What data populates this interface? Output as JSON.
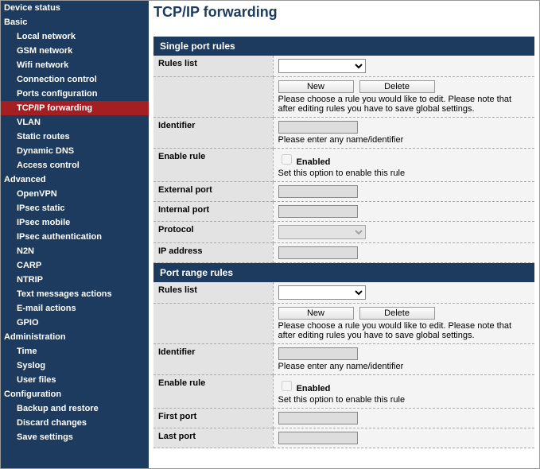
{
  "sidebar": [
    {
      "label": "Device status",
      "type": "group"
    },
    {
      "label": "Basic",
      "type": "group"
    },
    {
      "label": "Local network",
      "type": "child"
    },
    {
      "label": "GSM network",
      "type": "child"
    },
    {
      "label": "Wifi network",
      "type": "child"
    },
    {
      "label": "Connection control",
      "type": "child"
    },
    {
      "label": "Ports configuration",
      "type": "child"
    },
    {
      "label": "TCP/IP forwarding",
      "type": "child",
      "active": true
    },
    {
      "label": "VLAN",
      "type": "child"
    },
    {
      "label": "Static routes",
      "type": "child"
    },
    {
      "label": "Dynamic DNS",
      "type": "child"
    },
    {
      "label": "Access control",
      "type": "child"
    },
    {
      "label": "Advanced",
      "type": "group"
    },
    {
      "label": "OpenVPN",
      "type": "child"
    },
    {
      "label": "IPsec static",
      "type": "child"
    },
    {
      "label": "IPsec mobile",
      "type": "child"
    },
    {
      "label": "IPsec authentication",
      "type": "child"
    },
    {
      "label": "N2N",
      "type": "child"
    },
    {
      "label": "CARP",
      "type": "child"
    },
    {
      "label": "NTRIP",
      "type": "child"
    },
    {
      "label": "Text messages actions",
      "type": "child"
    },
    {
      "label": "E-mail actions",
      "type": "child"
    },
    {
      "label": "GPIO",
      "type": "child"
    },
    {
      "label": "Administration",
      "type": "group"
    },
    {
      "label": "Time",
      "type": "child"
    },
    {
      "label": "Syslog",
      "type": "child"
    },
    {
      "label": "User files",
      "type": "child"
    },
    {
      "label": "Configuration",
      "type": "group"
    },
    {
      "label": "Backup and restore",
      "type": "child"
    },
    {
      "label": "Discard changes",
      "type": "child"
    },
    {
      "label": "Save settings",
      "type": "child"
    }
  ],
  "page": {
    "title": "TCP/IP forwarding"
  },
  "single": {
    "section_title": "Single port rules",
    "labels": {
      "rules_list": "Rules list",
      "identifier": "Identifier",
      "enable_rule": "Enable rule",
      "external_port": "External port",
      "internal_port": "Internal port",
      "protocol": "Protocol",
      "ip_address": "IP address"
    },
    "buttons": {
      "new": "New",
      "delete": "Delete"
    },
    "help": {
      "rules_list": "Please choose a rule you would like to edit. Please note that after editing rules you have to save global settings.",
      "identifier": "Please enter any name/identifier",
      "enable_rule": "Set this option to enable this rule"
    },
    "enabled_label": "Enabled",
    "values": {
      "rules_list": "",
      "identifier": "",
      "enable_rule": false,
      "external_port": "",
      "internal_port": "",
      "protocol": "",
      "ip_address": ""
    }
  },
  "range": {
    "section_title": "Port range rules",
    "labels": {
      "rules_list": "Rules list",
      "identifier": "Identifier",
      "enable_rule": "Enable rule",
      "first_port": "First port",
      "last_port": "Last port"
    },
    "buttons": {
      "new": "New",
      "delete": "Delete"
    },
    "help": {
      "rules_list": "Please choose a rule you would like to edit. Please note that after editing rules you have to save global settings.",
      "identifier": "Please enter any name/identifier",
      "enable_rule": "Set this option to enable this rule"
    },
    "enabled_label": "Enabled",
    "values": {
      "rules_list": "",
      "identifier": "",
      "enable_rule": false,
      "first_port": "",
      "last_port": ""
    }
  }
}
